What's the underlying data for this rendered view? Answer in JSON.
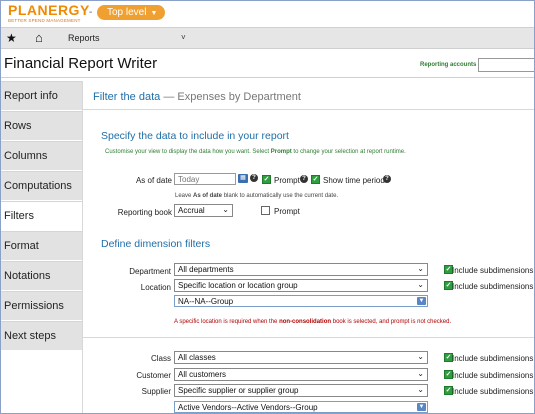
{
  "app": {
    "logo_text": "PLANERGY",
    "logo_tagline": "BETTER SPEND MANAGEMENT",
    "separator": "-",
    "level_button": "Top level",
    "brand_color": "#f08a00"
  },
  "nav": {
    "reports_label": "Reports"
  },
  "header": {
    "title": "Financial Report Writer",
    "reporting_accounts_label": "Reporting accounts",
    "reporting_accounts_value": ""
  },
  "sidebar": {
    "items": [
      {
        "label": "Report info"
      },
      {
        "label": "Rows"
      },
      {
        "label": "Columns"
      },
      {
        "label": "Computations"
      },
      {
        "label": "Filters"
      },
      {
        "label": "Format"
      },
      {
        "label": "Notations"
      },
      {
        "label": "Permissions"
      },
      {
        "label": "Next steps"
      }
    ],
    "active_index": 4
  },
  "main": {
    "filter_title": "Filter the data",
    "filter_subtitle": "— Expenses by Department",
    "section1": {
      "title": "Specify the data to include in your report",
      "note_pre": "Customise your view to display the data how you want. Select ",
      "note_bold": "Prompt",
      "note_post": " to change your selection at report runtime.",
      "as_of_date_label": "As of date",
      "as_of_date_placeholder": "Today",
      "prompt_label": "Prompt",
      "show_time_period_label": "Show time period",
      "hint_pre": "Leave ",
      "hint_bold": "As of date",
      "hint_post": " blank to automatically use the current date.",
      "reporting_book_label": "Reporting book",
      "reporting_book_value": "Accrual",
      "reporting_book_prompt_label": "Prompt"
    },
    "section2": {
      "title": "Define dimension filters",
      "include_subdimensions_label": "Include subdimensions",
      "department_label": "Department",
      "department_value": "All departments",
      "location_label": "Location",
      "location_value": "Specific location or location group",
      "location_group_value": "NA--NA--Group",
      "error_pre": "A specific location is required when the ",
      "error_bold": "non-consolidation",
      "error_post": " book is selected, and prompt is not checked.",
      "class_label": "Class",
      "class_value": "All classes",
      "customer_label": "Customer",
      "customer_value": "All customers",
      "supplier_label": "Supplier",
      "supplier_value": "Specific supplier or supplier group",
      "supplier_group_value": "Active Vendors--Active Vendors--Group"
    }
  }
}
